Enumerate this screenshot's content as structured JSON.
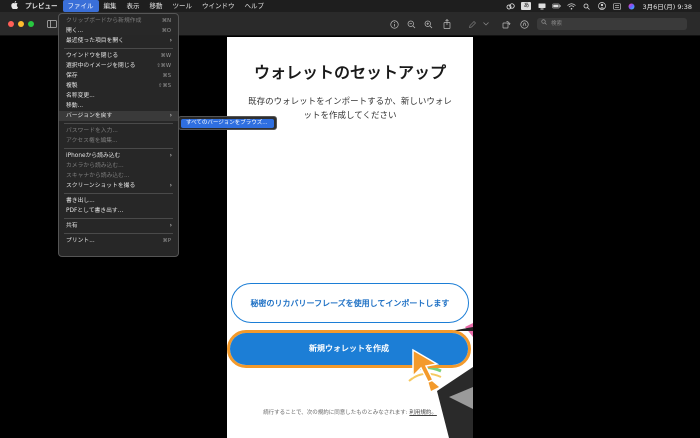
{
  "menubar": {
    "apple_icon": "apple-icon",
    "items": [
      {
        "label": "プレビュー"
      },
      {
        "label": "ファイル"
      },
      {
        "label": "編集"
      },
      {
        "label": "表示"
      },
      {
        "label": "移動"
      },
      {
        "label": "ツール"
      },
      {
        "label": "ウインドウ"
      },
      {
        "label": "ヘルプ"
      }
    ],
    "ime_label": "あ",
    "datetime": "3月6日(月)  9:38"
  },
  "toolbar": {
    "search_placeholder": "検索"
  },
  "file_menu": {
    "items": [
      {
        "label": "クリップボードから新規作成",
        "shortcut": "⌘N",
        "disabled": true
      },
      {
        "label": "開く...",
        "shortcut": "⌘O",
        "disabled": false
      },
      {
        "label": "最近使った項目を開く",
        "shortcut": "",
        "submenu": true,
        "disabled": false
      },
      {
        "label": "ウインドウを閉じる",
        "shortcut": "⌘W",
        "disabled": false
      },
      {
        "label": "選択中のイメージを閉じる",
        "shortcut": "⇧⌘W",
        "disabled": false
      },
      {
        "label": "保存",
        "shortcut": "⌘S",
        "disabled": false
      },
      {
        "label": "複製",
        "shortcut": "⇧⌘S",
        "disabled": false
      },
      {
        "label": "名称変更...",
        "shortcut": "",
        "disabled": false
      },
      {
        "label": "移動...",
        "shortcut": "",
        "disabled": false
      },
      {
        "label": "バージョンを戻す",
        "shortcut": "",
        "submenu": true,
        "disabled": false
      },
      {
        "label": "パスワードを入力...",
        "shortcut": "",
        "disabled": true
      },
      {
        "label": "アクセス権を編集...",
        "shortcut": "",
        "disabled": true
      },
      {
        "label": "iPhoneから読み込む",
        "shortcut": "",
        "submenu": true,
        "disabled": false
      },
      {
        "label": "カメラから読み込む...",
        "shortcut": "",
        "disabled": true
      },
      {
        "label": "スキャナから読み込む...",
        "shortcut": "",
        "disabled": true
      },
      {
        "label": "スクリーンショットを撮る",
        "shortcut": "",
        "submenu": true,
        "disabled": false
      },
      {
        "label": "書き出し...",
        "shortcut": "",
        "disabled": false
      },
      {
        "label": "PDFとして書き出す...",
        "shortcut": "",
        "disabled": false
      },
      {
        "label": "共有",
        "shortcut": "",
        "submenu": true,
        "disabled": false
      },
      {
        "label": "プリント...",
        "shortcut": "⌘P",
        "disabled": false
      }
    ],
    "submenu_item": "すべてのバージョンをブラウズ..."
  },
  "page": {
    "title": "ウォレットのセットアップ",
    "description": "既存のウォレットをインポートするか、新しいウォレットを作成してください",
    "import_button": "秘密のリカバリーフレーズを使用してインポートします",
    "create_button": "新規ウォレットを作成",
    "footer_prefix": "続行することで、次の規約に同意したものとみなされます: ",
    "footer_link": "利用規約。"
  },
  "colors": {
    "accent": "#1c7ed6",
    "highlight": "#f39a2b",
    "menu_selected": "#2f6fe0"
  }
}
